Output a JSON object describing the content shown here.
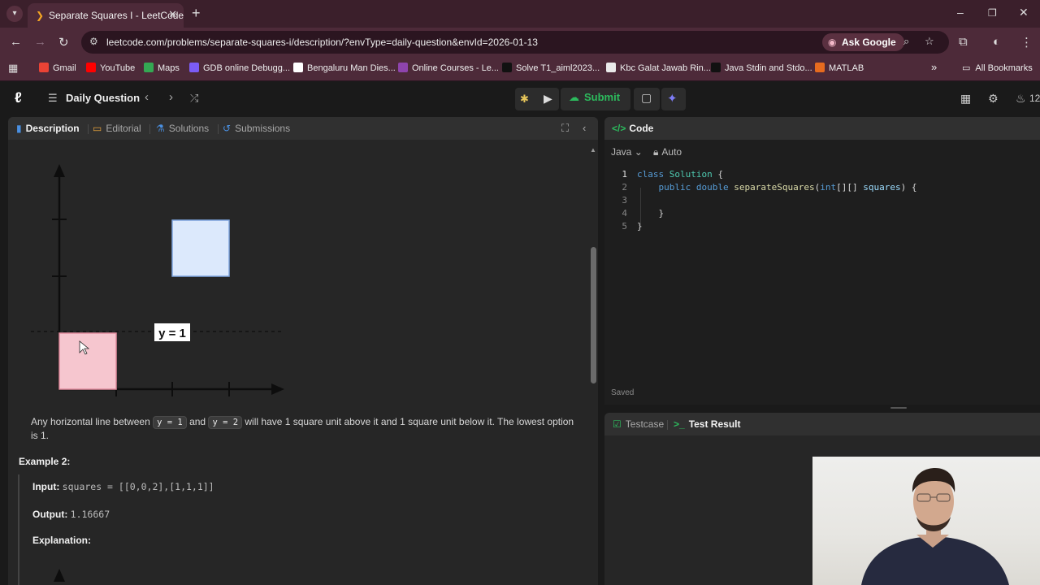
{
  "browser": {
    "tab_title": "Separate Squares I - LeetCode",
    "url": "leetcode.com/problems/separate-squares-i/description/?envType=daily-question&envId=2026-01-13",
    "ask_google": "Ask Google",
    "bookmarks": [
      {
        "label": "Gmail",
        "color": "#ea4335"
      },
      {
        "label": "YouTube",
        "color": "#ff0000"
      },
      {
        "label": "Maps",
        "color": "#34a853"
      },
      {
        "label": "GDB online Debugg...",
        "color": "#7b5cf5"
      },
      {
        "label": "Bengaluru Man Dies...",
        "color": "#ffffff"
      },
      {
        "label": "Online Courses - Le...",
        "color": "#8e44ad"
      },
      {
        "label": "Solve T1_aiml2023...",
        "color": "#111111"
      },
      {
        "label": "Kbc Galat Jawab Rin...",
        "color": "#e9e9e9"
      },
      {
        "label": "Java Stdin and Stdo...",
        "color": "#111111"
      },
      {
        "label": "MATLAB",
        "color": "#e66b1f"
      }
    ],
    "all_bookmarks": "All Bookmarks"
  },
  "toolbar": {
    "title": "Daily Question",
    "submit": "Submit",
    "streak": "12"
  },
  "left_tabs": {
    "description": "Description",
    "editorial": "Editorial",
    "solutions": "Solutions",
    "submissions": "Submissions"
  },
  "figure": {
    "label": "y = 1"
  },
  "description": {
    "p1": "Any horizontal line between",
    "code1": "y = 1",
    "p2": "and",
    "code2": "y = 2",
    "p3": "will have 1 square unit above it and 1 square unit below it. The lowest option is 1."
  },
  "example2": {
    "title": "Example 2:",
    "input_label": "Input:",
    "input_value": "squares = [[0,0,2],[1,1,1]]",
    "output_label": "Output:",
    "output_value": "1.16667",
    "explanation_label": "Explanation:"
  },
  "code_panel": {
    "title": "Code",
    "language": "Java",
    "mode": "Auto",
    "saved": "Saved",
    "lines": [
      {
        "n": "1"
      },
      {
        "n": "2"
      },
      {
        "n": "3"
      },
      {
        "n": "4"
      },
      {
        "n": "5"
      }
    ],
    "tokens": {
      "class_kw": "class",
      "class_name": "Solution",
      "brace_open": "{",
      "public_kw": "public",
      "double_kw": "double",
      "method": "separateSquares",
      "params_open": "(",
      "int_kw": "int",
      "arr": "[][]",
      "param": "squares",
      "params_close": ")",
      "close_inner": "}",
      "close_outer": "}"
    }
  },
  "test_panel": {
    "testcase": "Testcase",
    "test_result": "Test Result"
  }
}
